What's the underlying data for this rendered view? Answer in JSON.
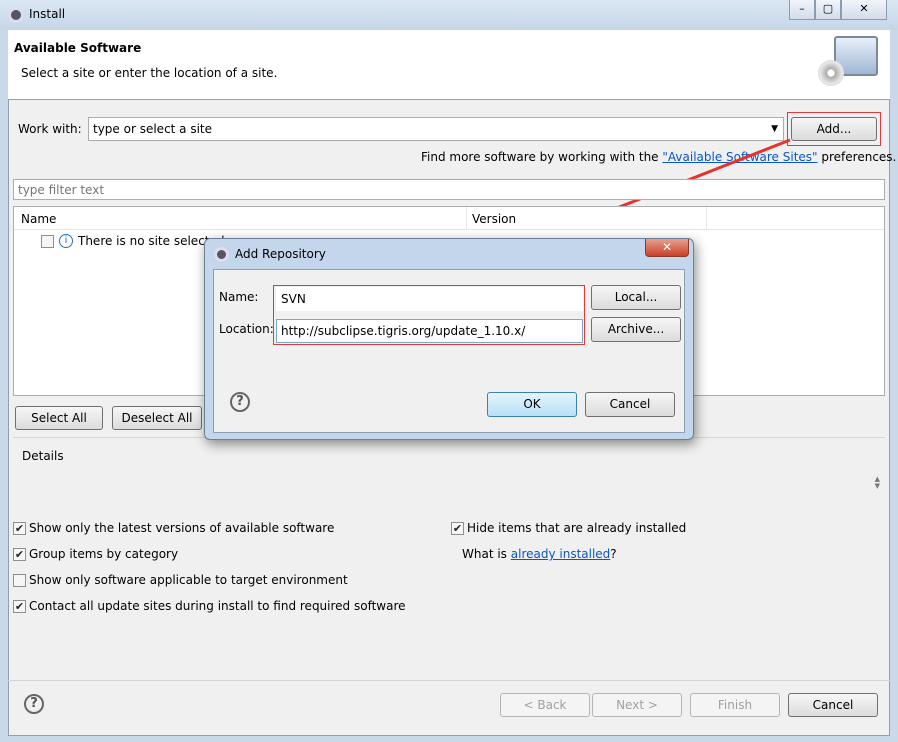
{
  "window": {
    "title": "Install",
    "icon": "eclipse-gear-icon"
  },
  "banner": {
    "title": "Available Software",
    "subtitle": "Select a site or enter the location of a site.",
    "icon": "monitor-cd-icon"
  },
  "work_with": {
    "label": "Work with:",
    "value": "type or select a site",
    "add_label": "Add..."
  },
  "find_more": {
    "prefix": "Find more software by working with the ",
    "link": "\"Available Software Sites\"",
    "suffix": " preferences."
  },
  "filter": {
    "placeholder": "type filter text"
  },
  "table": {
    "columns": [
      "Name",
      "Version"
    ],
    "rows": [
      {
        "name": "There is no site selected.",
        "checked": false
      }
    ]
  },
  "buttons": {
    "select_all": "Select All",
    "deselect_all": "Deselect All"
  },
  "details": {
    "label": "Details"
  },
  "options": [
    {
      "label": "Show only the latest versions of available software",
      "checked": true
    },
    {
      "label": "Group items by category",
      "checked": true
    },
    {
      "label": "Show only software applicable to target environment",
      "checked": false
    },
    {
      "label": "Contact all update sites during install to find required software",
      "checked": true
    },
    {
      "label": "Hide items that are already installed",
      "checked": true
    }
  ],
  "what_is": {
    "prefix": "What is ",
    "link": "already installed",
    "suffix": "?"
  },
  "footer": {
    "back": "< Back",
    "next": "Next >",
    "finish": "Finish",
    "cancel": "Cancel"
  },
  "dialog": {
    "title": "Add Repository",
    "name_label": "Name:",
    "name_value": "SVN",
    "location_label": "Location:",
    "location_value": "http://subclipse.tigris.org/update_1.10.x/",
    "local": "Local...",
    "archive": "Archive...",
    "ok": "OK",
    "cancel": "Cancel"
  },
  "annotation_color": "#e03a3a"
}
